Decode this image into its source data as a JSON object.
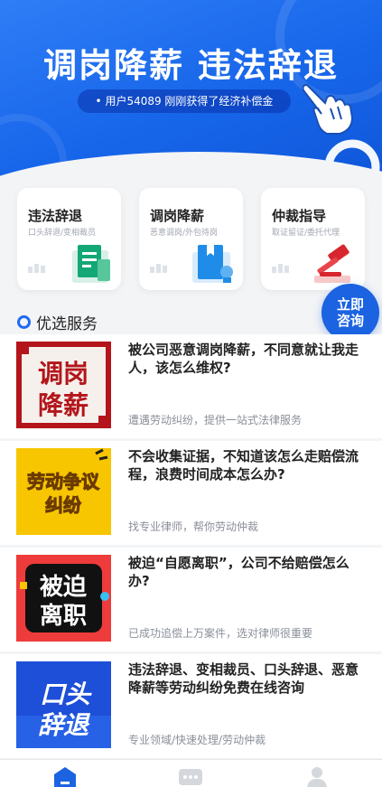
{
  "hero": {
    "title": "调岗降薪 违法辞退",
    "notice": "• 用户54089 刚刚获得了经济补偿金"
  },
  "categories": [
    {
      "title": "违法辞退",
      "subtitle": "口头辞退/变相裁员",
      "icon": "document-icon"
    },
    {
      "title": "调岗降薪",
      "subtitle": "恶意调岗/外包待岗",
      "icon": "book-icon"
    },
    {
      "title": "仲裁指导",
      "subtitle": "取证留证/委托代理",
      "icon": "gavel-icon"
    }
  ],
  "consult": {
    "line1": "立即",
    "line2": "咨询"
  },
  "section": {
    "title": "优选服务"
  },
  "services": [
    {
      "thumb_text1": "调岗",
      "thumb_text2": "降薪",
      "title": "被公司恶意调岗降薪，不同意就让我走人，该怎么维权?",
      "desc": "遭遇劳动纠纷，提供一站式法律服务"
    },
    {
      "thumb_text1": "劳动争议",
      "thumb_text2": "纠纷",
      "title": "不会收集证据，不知道该怎么走赔偿流程，浪费时间成本怎么办?",
      "desc": "找专业律师，帮你劳动仲裁"
    },
    {
      "thumb_text1": "被迫",
      "thumb_text2": "离职",
      "title": "被迫“自愿离职”，公司不给赔偿怎么办?",
      "desc": "已成功追偿上万案件，选对律师很重要"
    },
    {
      "thumb_text1": "口头",
      "thumb_text2": "辞退",
      "title": "违法辞退、变相裁员、口头辞退、恶意降薪等劳动纠纷免费在线咨询",
      "desc": "专业领域/快速处理/劳动仲裁"
    }
  ],
  "tabbar": [
    {
      "icon": "home-icon",
      "active": true
    },
    {
      "icon": "message-icon",
      "active": false
    },
    {
      "icon": "user-icon",
      "active": false
    }
  ],
  "colors": {
    "primary": "#1b63e0",
    "background": "#f3f4f6",
    "thumb_red": "#b3151b",
    "thumb_yellow": "#f7c600"
  }
}
